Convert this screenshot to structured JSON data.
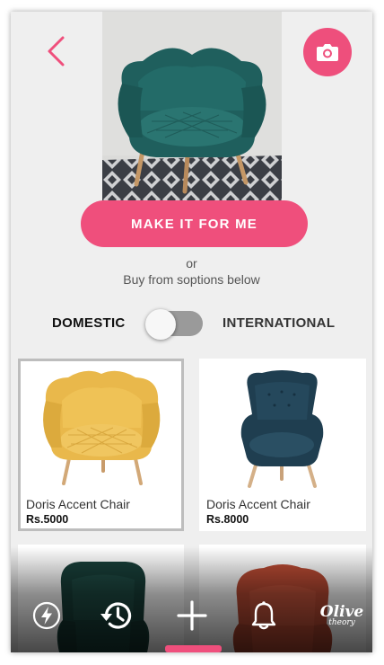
{
  "header": {
    "back_icon": "chevron-left-icon",
    "camera_icon": "camera-icon"
  },
  "hero": {
    "image": "teal-armchair-photo"
  },
  "cta": {
    "make_label": "MAKE IT FOR ME",
    "or_text": "or",
    "buy_text": "Buy from soptions below"
  },
  "toggle": {
    "left_label": "DOMESTIC",
    "right_label": "INTERNATIONAL",
    "selected": "DOMESTIC"
  },
  "products": [
    {
      "name": "Doris Accent Chair",
      "price": "Rs.5000",
      "color": "#e9b84b",
      "selected": true
    },
    {
      "name": "Doris Accent Chair",
      "price": "Rs.8000",
      "color": "#1f3e50",
      "selected": false
    },
    {
      "color": "#183f39"
    },
    {
      "color": "#b94a33"
    }
  ],
  "bottom_nav": {
    "items": [
      "flash-icon",
      "history-icon",
      "add-icon",
      "bell-icon",
      "brand-logo"
    ],
    "active": "add-icon",
    "brand_name": "Olive",
    "brand_sub": "theory"
  },
  "colors": {
    "accent": "#ef4f7c",
    "background": "#efefef"
  }
}
